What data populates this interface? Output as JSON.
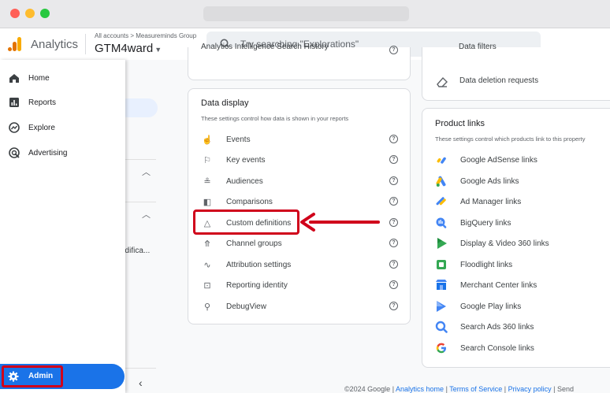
{
  "appbar": {
    "brand": "Analytics",
    "breadcrumb": "All accounts > Measureminds Group",
    "property": "GTM4ward",
    "search_placeholder": "Try searching \"Explorations\""
  },
  "nav": {
    "items": [
      {
        "label": "Home",
        "icon": "home-icon"
      },
      {
        "label": "Reports",
        "icon": "reports-icon"
      },
      {
        "label": "Explore",
        "icon": "explore-icon"
      },
      {
        "label": "Advertising",
        "icon": "advertising-icon"
      }
    ],
    "admin_label": "Admin"
  },
  "background": {
    "truncated_text": "odifica..."
  },
  "top_cards": {
    "left_partial": "Analytics Intelligence Search History",
    "right_partial_1": "Data filters",
    "right_partial_2": "Data deletion requests"
  },
  "data_display": {
    "title": "Data display",
    "subtitle": "These settings control how data is shown in your reports",
    "items": [
      {
        "label": "Events",
        "icon": "touch-icon"
      },
      {
        "label": "Key events",
        "icon": "flag-icon"
      },
      {
        "label": "Audiences",
        "icon": "audiences-icon"
      },
      {
        "label": "Comparisons",
        "icon": "comparisons-icon"
      },
      {
        "label": "Custom definitions",
        "icon": "shapes-icon"
      },
      {
        "label": "Channel groups",
        "icon": "merge-icon"
      },
      {
        "label": "Attribution settings",
        "icon": "route-icon"
      },
      {
        "label": "Reporting identity",
        "icon": "identity-icon"
      },
      {
        "label": "DebugView",
        "icon": "debug-icon"
      }
    ]
  },
  "product_links": {
    "title": "Product links",
    "subtitle": "These settings control which products link to this property",
    "items": [
      {
        "label": "Google AdSense links",
        "icon": "adsense-icon"
      },
      {
        "label": "Google Ads links",
        "icon": "google-ads-icon"
      },
      {
        "label": "Ad Manager links",
        "icon": "ad-manager-icon"
      },
      {
        "label": "BigQuery links",
        "icon": "bigquery-icon"
      },
      {
        "label": "Display & Video 360 links",
        "icon": "dv360-icon"
      },
      {
        "label": "Floodlight links",
        "icon": "floodlight-icon"
      },
      {
        "label": "Merchant Center links",
        "icon": "merchant-center-icon"
      },
      {
        "label": "Google Play links",
        "icon": "google-play-icon"
      },
      {
        "label": "Search Ads 360 links",
        "icon": "search-ads-360-icon"
      },
      {
        "label": "Search Console links",
        "icon": "google-g-icon"
      }
    ]
  },
  "footer": {
    "copyright": "©2024 Google",
    "links": [
      "Analytics home",
      "Terms of Service",
      "Privacy policy",
      "Send"
    ]
  },
  "colors": {
    "accent": "#1a73e8",
    "highlight": "#d0021b"
  }
}
